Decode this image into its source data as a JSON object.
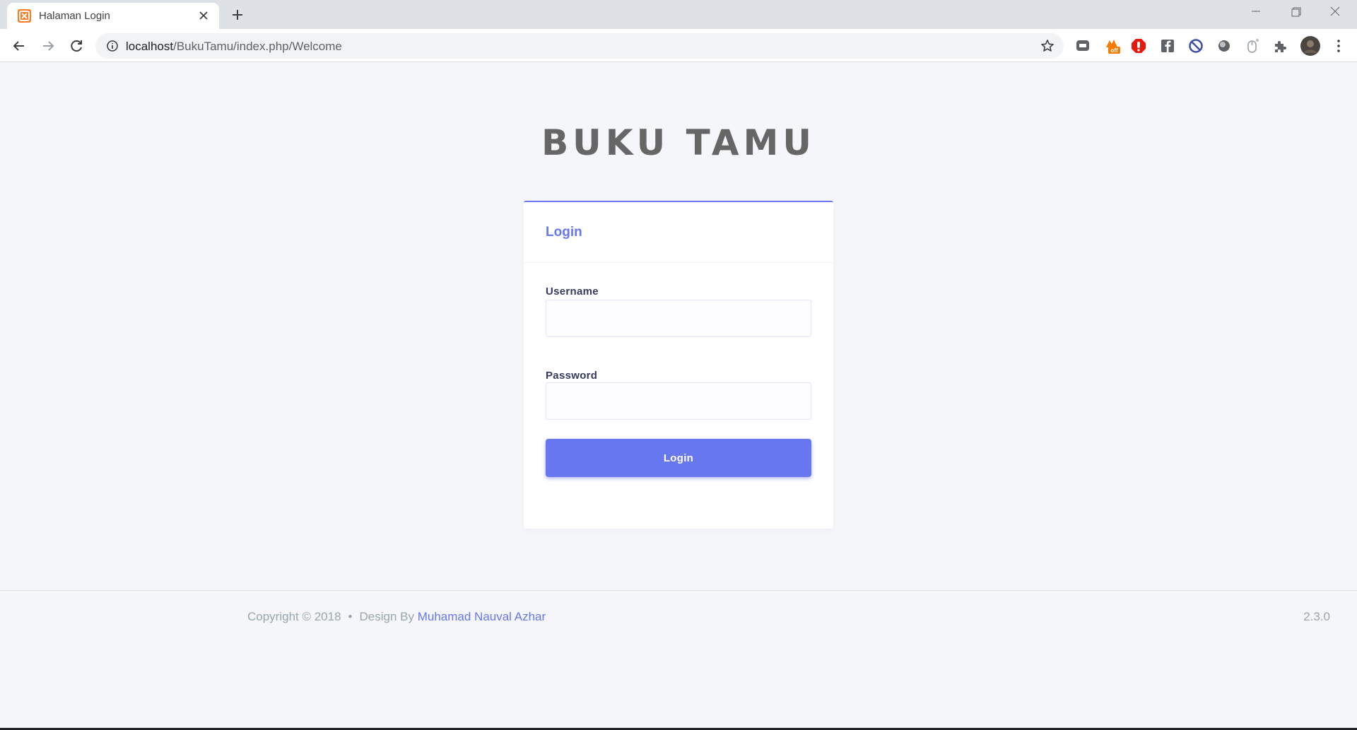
{
  "browser": {
    "tab_title": "Halaman Login",
    "url_host": "localhost",
    "url_path": "/BukuTamu/index.php/Welcome",
    "extensions": [
      {
        "name": "line-extension-icon",
        "color": "#5f6368"
      },
      {
        "name": "honey-extension-icon",
        "color": "#f57c00",
        "badge": "off"
      },
      {
        "name": "adblock-extension-icon",
        "color": "#e8180c"
      },
      {
        "name": "facebook-extension-icon",
        "color": "#5f6368"
      },
      {
        "name": "block-extension-icon",
        "color": "#3b4fa0"
      },
      {
        "name": "circle-extension-icon",
        "color": "#5f6368"
      },
      {
        "name": "mouse-extension-icon",
        "color": "#9aa0a6"
      },
      {
        "name": "puzzle-extensions-icon",
        "color": "#5f6368"
      }
    ]
  },
  "page": {
    "brand": "BUKU TAMU",
    "card": {
      "title": "Login",
      "username_label": "Username",
      "username_value": "",
      "password_label": "Password",
      "password_value": "",
      "submit_label": "Login"
    },
    "footer": {
      "copyright": "Copyright © 2018",
      "bullet": "•",
      "design_by": "Design By",
      "author": "Muhamad Nauval Azhar",
      "version": "2.3.0"
    }
  },
  "colors": {
    "primary": "#6777ef",
    "page_bg": "#f4f6f9",
    "brand_text": "#666666"
  }
}
